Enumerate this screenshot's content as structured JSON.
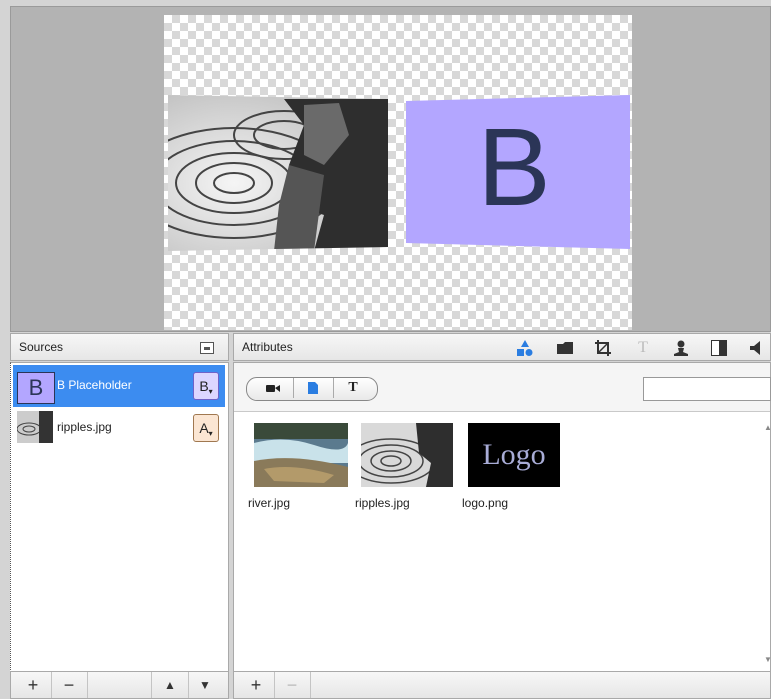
{
  "sources_panel": {
    "title": "Sources",
    "items": [
      {
        "label": "B Placeholder",
        "thumb_letter": "B",
        "badge": "B",
        "selected": true
      },
      {
        "label": "ripples.jpg",
        "badge": "A",
        "selected": false
      }
    ],
    "footer": {
      "add": "+",
      "remove": "−",
      "up": "▲",
      "down": "▼"
    }
  },
  "attributes_panel": {
    "title": "Attributes",
    "toolbar_icons": [
      "shapes-icon",
      "folder-icon",
      "crop-icon",
      "text-icon",
      "person-icon",
      "split-icon",
      "speaker-icon"
    ],
    "segment": {
      "text_label": "T"
    },
    "files": [
      {
        "label": "river.jpg"
      },
      {
        "label": "ripples.jpg"
      },
      {
        "label": "logo.png",
        "thumb_text": "Logo"
      }
    ],
    "footer": {
      "add": "+",
      "remove": "−"
    }
  },
  "preview": {
    "placeholder_letter": "B",
    "placeholder_color": "#b3a6ff",
    "placeholder_text_color": "#2b3557"
  },
  "colors": {
    "selection": "#3c8cf0",
    "accent_blue": "#2a7de1"
  }
}
